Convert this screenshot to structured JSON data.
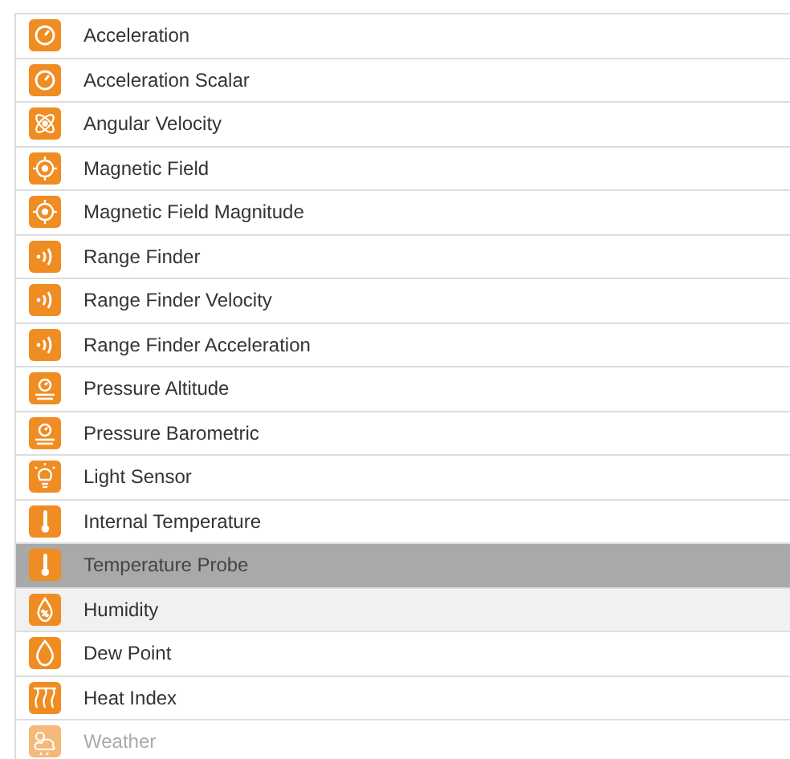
{
  "sensors": [
    {
      "label": "Acceleration",
      "kind": "gauge",
      "selected": false,
      "hovered": false,
      "disabled": false
    },
    {
      "label": "Acceleration Scalar",
      "kind": "gauge",
      "selected": false,
      "hovered": false,
      "disabled": false
    },
    {
      "label": "Angular Velocity",
      "kind": "orbit",
      "selected": false,
      "hovered": false,
      "disabled": false
    },
    {
      "label": "Magnetic Field",
      "kind": "compass",
      "selected": false,
      "hovered": false,
      "disabled": false
    },
    {
      "label": "Magnetic Field Magnitude",
      "kind": "compass",
      "selected": false,
      "hovered": false,
      "disabled": false
    },
    {
      "label": "Range Finder",
      "kind": "waves",
      "selected": false,
      "hovered": false,
      "disabled": false
    },
    {
      "label": "Range Finder Velocity",
      "kind": "waves",
      "selected": false,
      "hovered": false,
      "disabled": false
    },
    {
      "label": "Range Finder Acceleration",
      "kind": "waves",
      "selected": false,
      "hovered": false,
      "disabled": false
    },
    {
      "label": "Pressure Altitude",
      "kind": "pressure",
      "selected": false,
      "hovered": false,
      "disabled": false
    },
    {
      "label": "Pressure Barometric",
      "kind": "pressure",
      "selected": false,
      "hovered": false,
      "disabled": false
    },
    {
      "label": "Light Sensor",
      "kind": "bulb",
      "selected": false,
      "hovered": false,
      "disabled": false
    },
    {
      "label": "Internal Temperature",
      "kind": "thermometer",
      "selected": false,
      "hovered": false,
      "disabled": false
    },
    {
      "label": "Temperature Probe",
      "kind": "thermometer",
      "selected": true,
      "hovered": false,
      "disabled": false
    },
    {
      "label": "Humidity",
      "kind": "humidity",
      "selected": false,
      "hovered": true,
      "disabled": false
    },
    {
      "label": "Dew Point",
      "kind": "drop",
      "selected": false,
      "hovered": false,
      "disabled": false
    },
    {
      "label": "Heat Index",
      "kind": "heat",
      "selected": false,
      "hovered": false,
      "disabled": false
    },
    {
      "label": "Weather",
      "kind": "weather",
      "selected": false,
      "hovered": false,
      "disabled": true
    }
  ]
}
